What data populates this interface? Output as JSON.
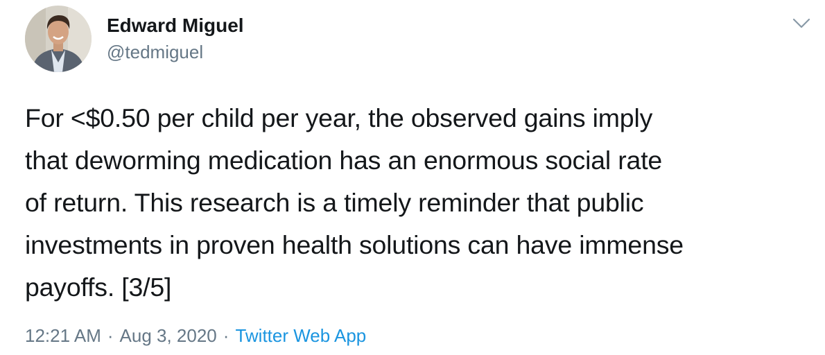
{
  "author": {
    "display_name": "Edward Miguel",
    "handle": "@tedmiguel",
    "avatar_icon": "profile-photo"
  },
  "tweet": {
    "text_lines": [
      "For <$0.50 per child per year, the observed gains imply",
      "that deworming medication has an enormous social rate",
      "of return. This research is a timely reminder that public",
      "investments in proven health solutions can have immense",
      "payoffs. [3/5]"
    ]
  },
  "meta": {
    "time": "12:21 AM",
    "separator": "·",
    "date": "Aug 3, 2020",
    "source": "Twitter Web App"
  },
  "icons": {
    "menu": "chevron-down-icon"
  },
  "colors": {
    "text": "#14171a",
    "secondary": "#657786",
    "link": "#1b95e0"
  }
}
